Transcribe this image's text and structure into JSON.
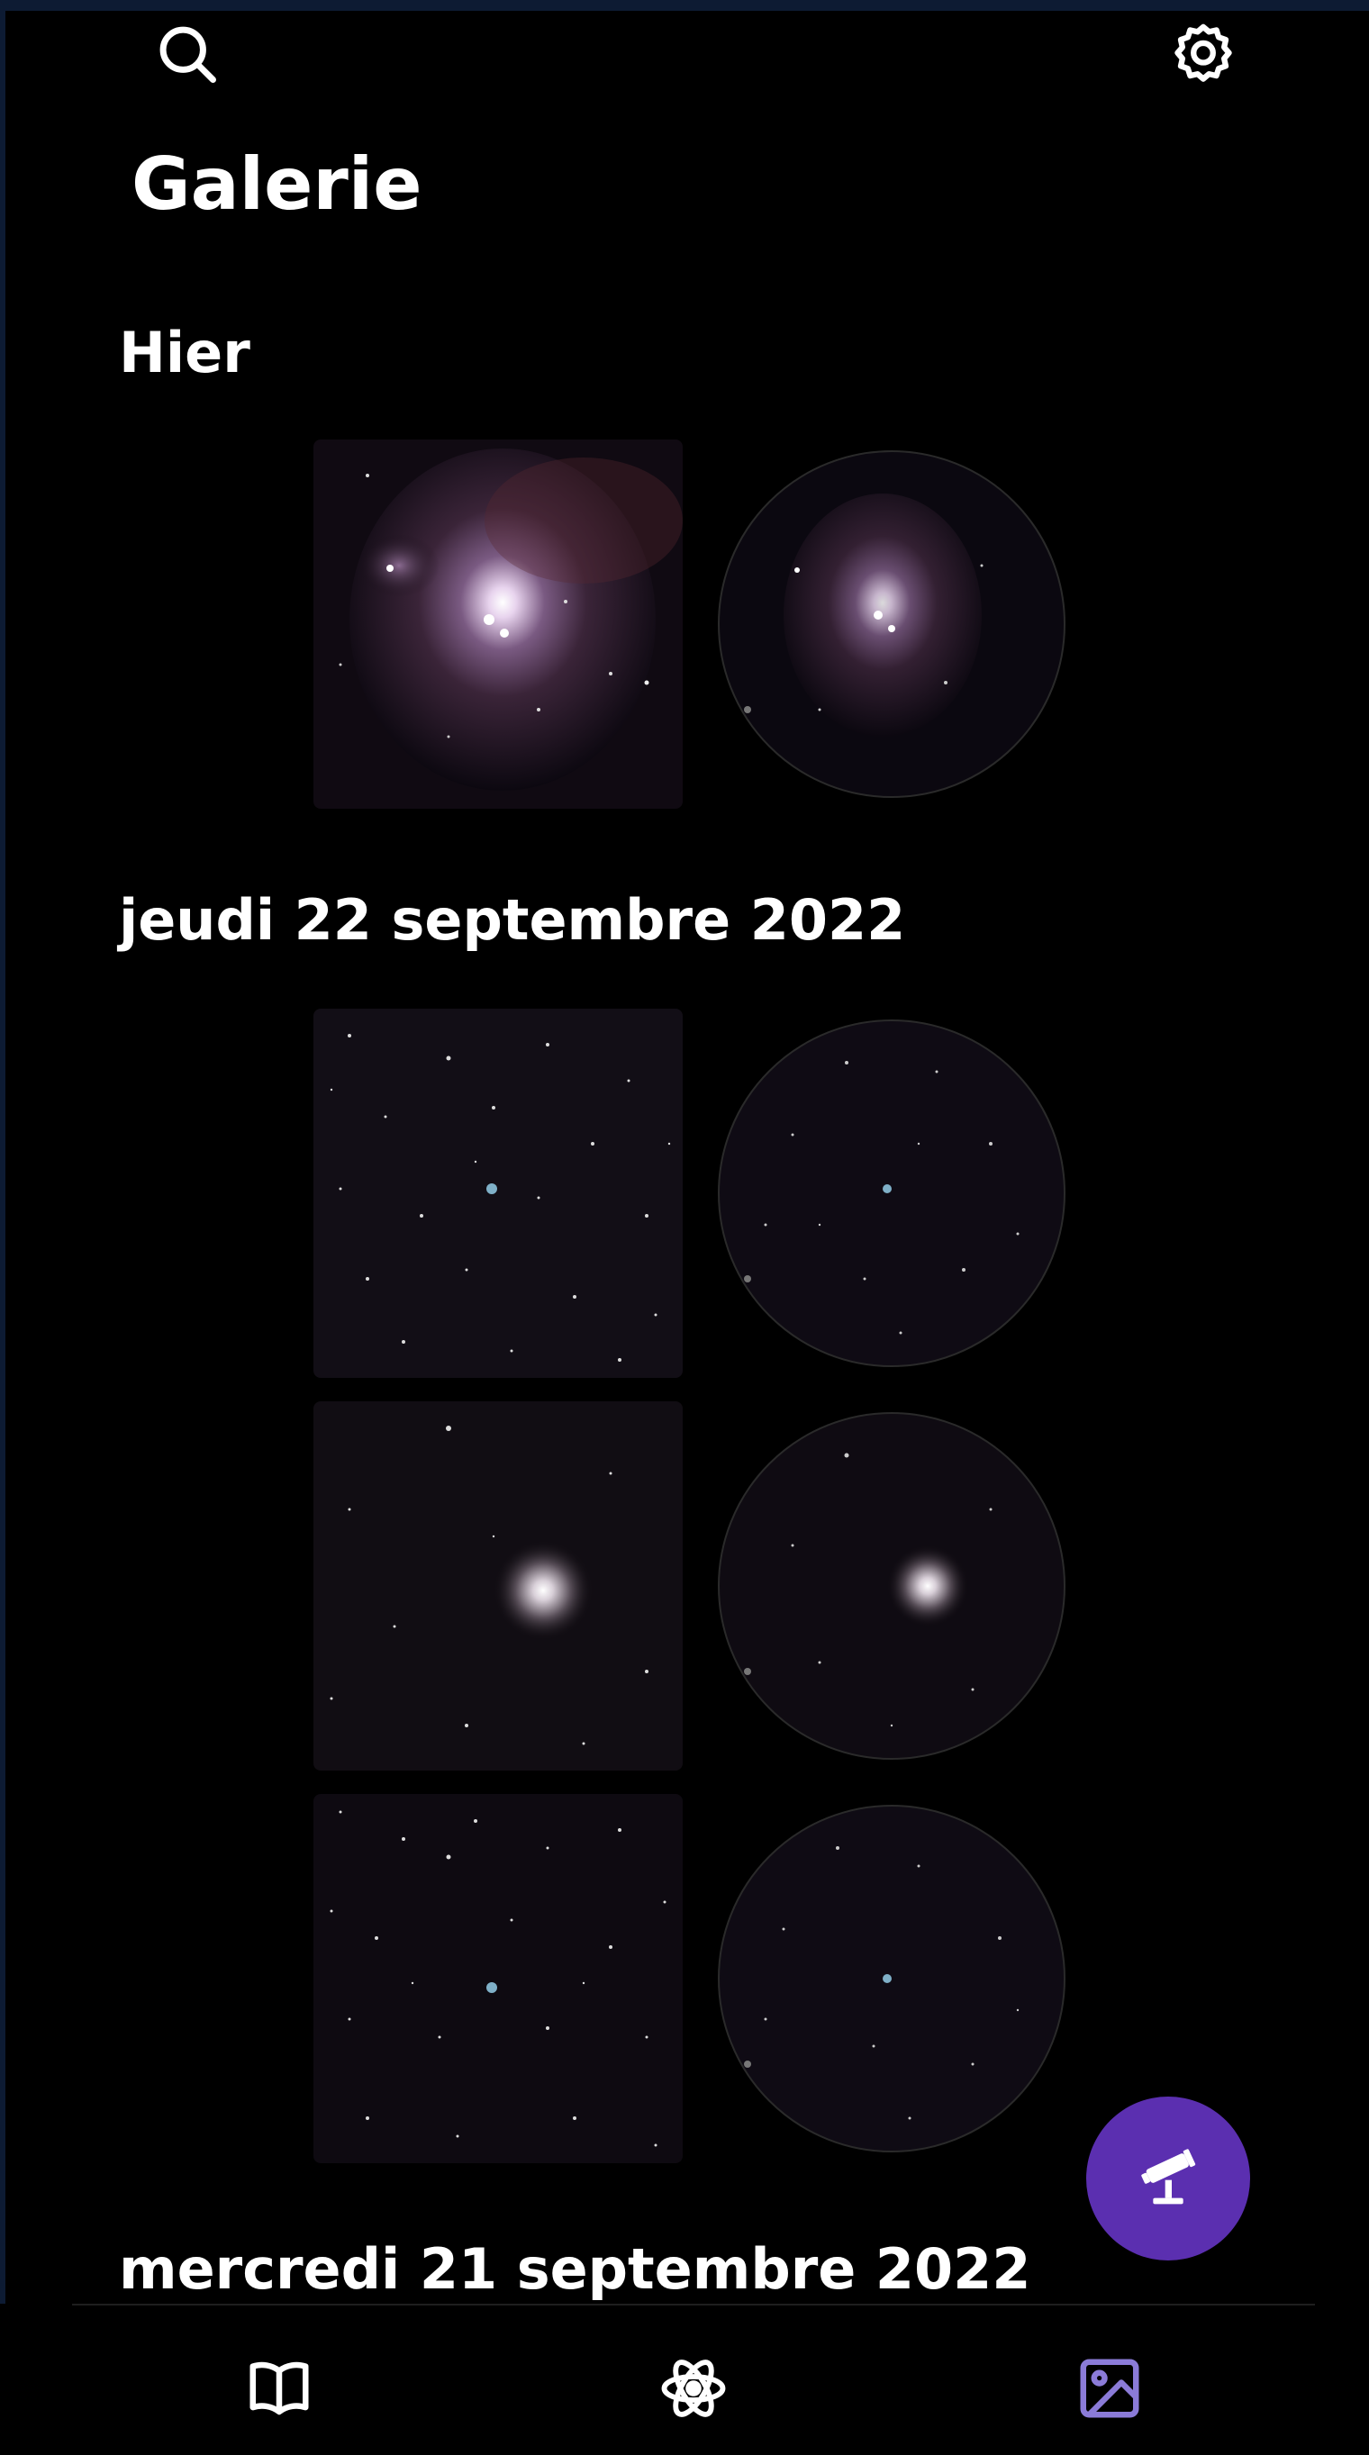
{
  "header": {
    "search_icon": "search-icon",
    "settings_icon": "gear-icon"
  },
  "page": {
    "title": "Galerie"
  },
  "sections": [
    {
      "title": "Hier",
      "rows": [
        {
          "object": "orion-nebula"
        }
      ]
    },
    {
      "title": "jeudi 22 septembre 2022",
      "rows": [
        {
          "object": "ring-nebula"
        },
        {
          "object": "globular-cluster"
        },
        {
          "object": "ring-nebula-field"
        }
      ]
    },
    {
      "title": "mercredi 21 septembre 2022",
      "rows": []
    }
  ],
  "fab": {
    "icon": "telescope-icon",
    "color": "#5b2fb0"
  },
  "bottom_nav": {
    "items": [
      {
        "id": "catalog",
        "icon": "book-icon",
        "active": false
      },
      {
        "id": "science",
        "icon": "atom-icon",
        "active": false
      },
      {
        "id": "gallery",
        "icon": "image-icon",
        "active": true
      }
    ],
    "active_color": "#8b7bd8",
    "inactive_color": "#ffffff"
  }
}
